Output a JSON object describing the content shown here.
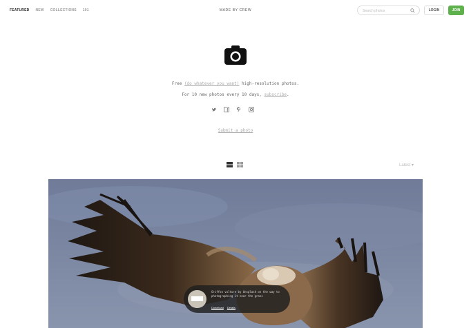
{
  "header": {
    "nav": [
      {
        "label": "FEATURED",
        "active": true
      },
      {
        "label": "NEW",
        "active": false
      },
      {
        "label": "COLLECTIONS",
        "active": false
      },
      {
        "label": "101",
        "active": false
      }
    ],
    "brand": "MADE BY CREW",
    "search": {
      "placeholder": "Search photos",
      "value": ""
    },
    "login_label": "LOGIN",
    "join_label": "JOIN",
    "join_color": "#5fb14e"
  },
  "hero": {
    "icon": "camera-icon",
    "line1_pre": "Free ",
    "line1_link": "(do whatever you want)",
    "line1_post": " high-resolution photos.",
    "line2_pre": "For 10 new photos every 10 days, ",
    "line2_link": "subscribe",
    "line2_post": ".",
    "social": [
      "twitter-icon",
      "facebook-icon",
      "pinterest-icon",
      "instagram-icon"
    ],
    "submit_label": "Submit a photo"
  },
  "controls": {
    "view_modes": [
      "list-view-icon",
      "grid-view-icon"
    ],
    "sort_label": "Latest ▾"
  },
  "photo": {
    "subject": "vulture in flight",
    "credit": {
      "text": "Griffon vulture by Unsplash on the way to photographing it near the grass",
      "links": [
        "Download",
        "Details"
      ]
    }
  }
}
